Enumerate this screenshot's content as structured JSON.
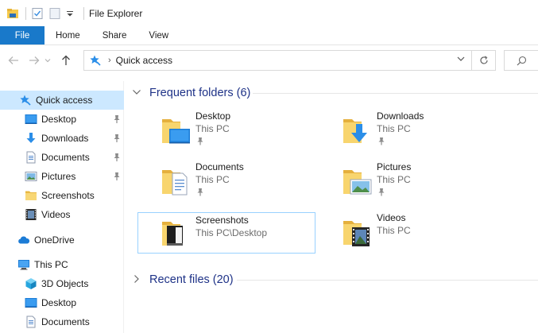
{
  "window": {
    "title": "File Explorer"
  },
  "ribbon": {
    "tabs": [
      {
        "label": "File",
        "active": true
      },
      {
        "label": "Home"
      },
      {
        "label": "Share"
      },
      {
        "label": "View"
      }
    ]
  },
  "address": {
    "location": "Quick access"
  },
  "sidebar": {
    "items": [
      {
        "label": "Quick access",
        "icon": "star-pin-icon",
        "selected": true,
        "pinned": false
      },
      {
        "label": "Desktop",
        "icon": "desktop-icon",
        "pinned": true
      },
      {
        "label": "Downloads",
        "icon": "download-arrow-icon",
        "pinned": true
      },
      {
        "label": "Documents",
        "icon": "document-icon",
        "pinned": true
      },
      {
        "label": "Pictures",
        "icon": "pictures-icon",
        "pinned": true
      },
      {
        "label": "Screenshots",
        "icon": "folder-icon",
        "pinned": false
      },
      {
        "label": "Videos",
        "icon": "film-icon",
        "pinned": false
      },
      {
        "label": "OneDrive",
        "icon": "cloud-icon",
        "pinned": false
      },
      {
        "label": "This PC",
        "icon": "computer-icon",
        "pinned": false
      },
      {
        "label": "3D Objects",
        "icon": "cube-icon",
        "pinned": false
      },
      {
        "label": "Desktop",
        "icon": "desktop-icon",
        "pinned": false
      },
      {
        "label": "Documents",
        "icon": "document-icon",
        "pinned": false
      }
    ]
  },
  "main": {
    "frequent": {
      "header": "Frequent folders (6)",
      "folders": [
        {
          "name": "Desktop",
          "path": "This PC",
          "pinned": true,
          "icon": "desktop-folder-icon"
        },
        {
          "name": "Downloads",
          "path": "This PC",
          "pinned": true,
          "icon": "downloads-folder-icon"
        },
        {
          "name": "Documents",
          "path": "This PC",
          "pinned": true,
          "icon": "documents-folder-icon"
        },
        {
          "name": "Pictures",
          "path": "This PC",
          "pinned": true,
          "icon": "pictures-folder-icon"
        },
        {
          "name": "Screenshots",
          "path": "This PC\\Desktop",
          "pinned": false,
          "icon": "screenshots-folder-icon"
        },
        {
          "name": "Videos",
          "path": "This PC",
          "pinned": false,
          "icon": "videos-folder-icon"
        }
      ]
    },
    "recent": {
      "header": "Recent files (20)"
    }
  },
  "colors": {
    "accent": "#1979ca",
    "selection": "#cce8ff",
    "group_header": "#1e3287",
    "folder": "#f6d36b"
  }
}
